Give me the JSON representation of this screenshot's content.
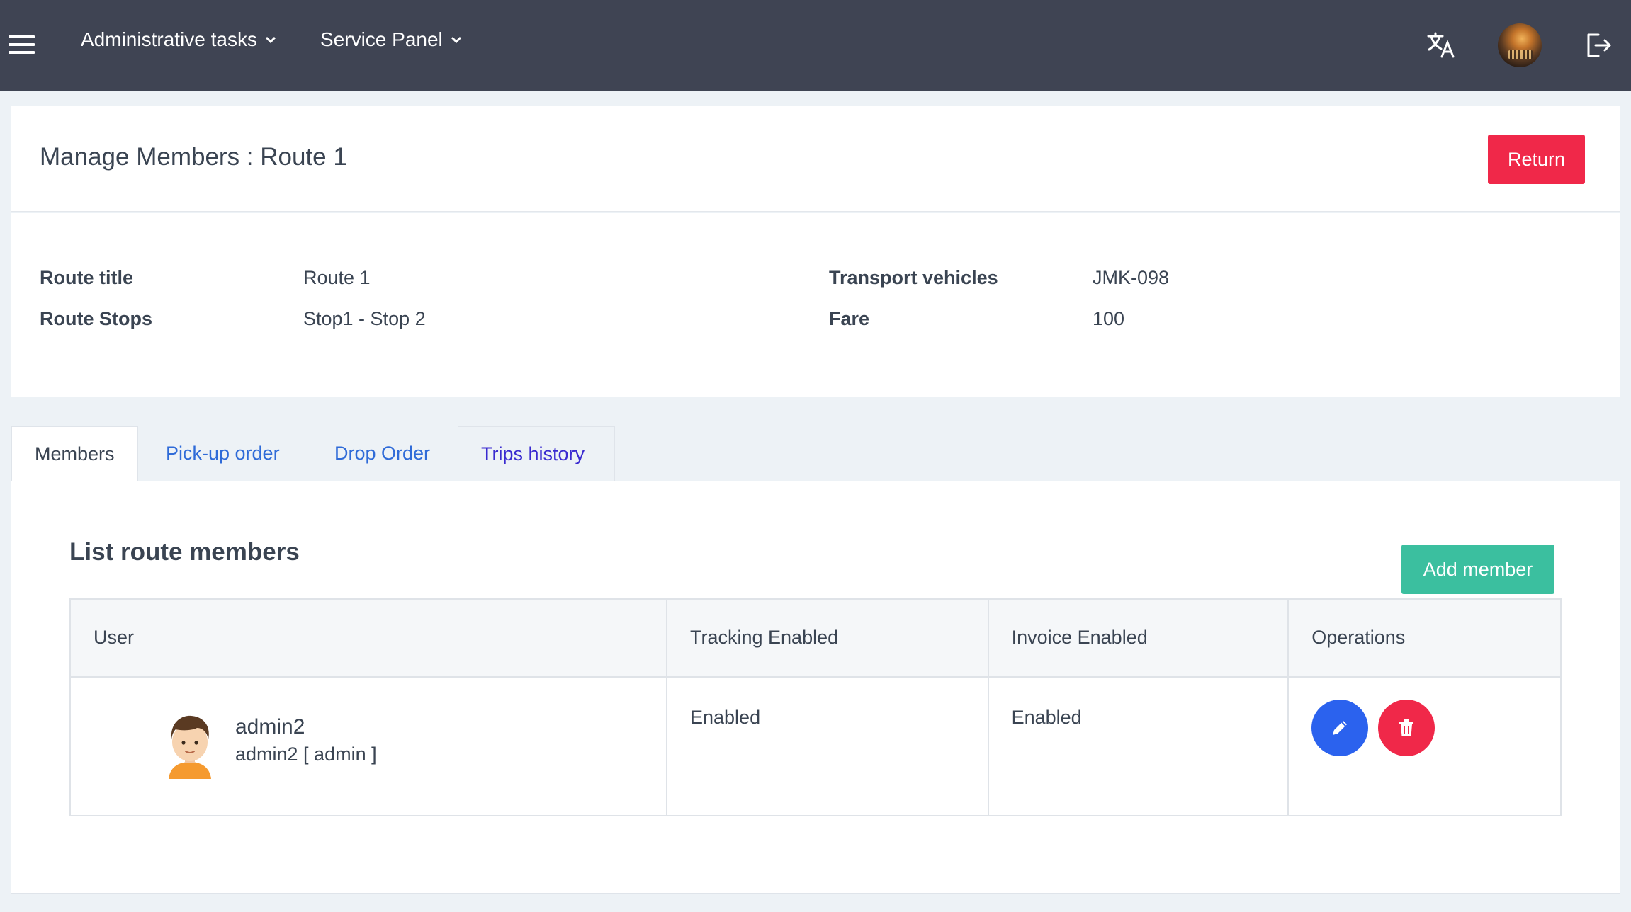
{
  "navbar": {
    "menu_icon": "hamburger-icon",
    "menus": [
      {
        "label": "Administrative tasks"
      },
      {
        "label": "Service Panel"
      }
    ],
    "icons": [
      "translate-icon",
      "user-avatar",
      "logout-icon"
    ]
  },
  "header": {
    "title": "Manage Members : Route 1",
    "return_label": "Return"
  },
  "details": {
    "route_title_label": "Route title",
    "route_title_value": "Route 1",
    "route_stops_label": "Route Stops",
    "route_stops_value": "Stop1 - Stop 2",
    "vehicles_label": "Transport vehicles",
    "vehicles_value": "JMK-098",
    "fare_label": "Fare",
    "fare_value": "100"
  },
  "tabs": [
    {
      "label": "Members",
      "active": true
    },
    {
      "label": "Pick-up order",
      "active": false
    },
    {
      "label": "Drop Order",
      "active": false
    },
    {
      "label": "Trips history",
      "active": false
    }
  ],
  "panel": {
    "title": "List route members",
    "add_label": "Add member",
    "columns": [
      "User",
      "Tracking Enabled",
      "Invoice Enabled",
      "Operations"
    ],
    "rows": [
      {
        "user_name": "admin2",
        "user_sub": "admin2 [ admin ]",
        "tracking": "Enabled",
        "invoice": "Enabled",
        "operations": [
          "edit-icon",
          "trash-icon"
        ]
      }
    ]
  },
  "colors": {
    "navbar": "#3f4453",
    "return": "#f02849",
    "add": "#3bbf9f",
    "edit": "#2b62ee",
    "delete": "#f02849"
  }
}
